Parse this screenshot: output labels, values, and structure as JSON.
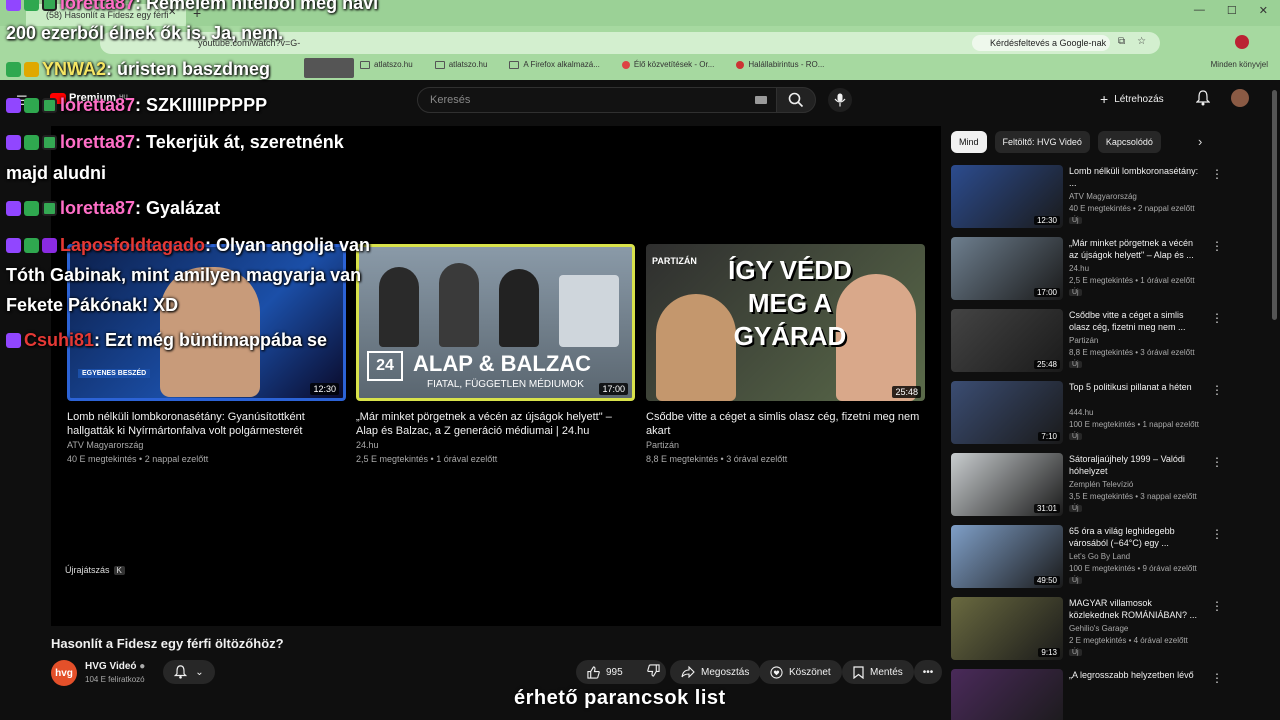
{
  "browser": {
    "tab_title": "(58) Hasonlít a Fidesz egy férfi",
    "url": "youtube.com/watch?v=G-",
    "search_chip": "Kérdésfeltevés a Google-nak",
    "bookmarks": [
      {
        "label": "atlatszo.hu",
        "icon": "folder-icon"
      },
      {
        "label": "atlatszo.hu",
        "icon": "folder-icon"
      },
      {
        "label": "A Firefox alkalmazá...",
        "icon": "folder-icon"
      },
      {
        "label": "Élő közvetítések - Or...",
        "icon": "live-icon"
      },
      {
        "label": "Halállabirintus - RO...",
        "icon": "site-icon"
      }
    ],
    "other_bookmarks": "Minden könyvjel"
  },
  "header": {
    "logo_text": "Premium",
    "logo_region": "HU",
    "search_placeholder": "Keresés",
    "create_label": "Létrehozás"
  },
  "endcards": [
    {
      "title": "Lomb nélküli lombkoronasétány: Gyanúsítottként hallgatták ki Nyírmártonfalva volt polgármesterét",
      "channel": "ATV Magyarország",
      "stats": "40 E megtekintés • 2 nappal ezelőtt",
      "duration": "12:30",
      "thumb_text": "EGYENES BESZÉD",
      "thumb_color": "#1b4fa8"
    },
    {
      "title": "„Már minket pörgetnek a vécén az újságok helyett\" – Alap és Balzac, a Z generáció médiumai | 24.hu",
      "channel": "24.hu",
      "stats": "2,5 E megtekintés • 1 órával ezelőtt",
      "duration": "17:00",
      "thumb_text": "ALAP & BALZAC",
      "thumb_subtext": "FIATAL, FÜGGETLEN MÉDIUMOK",
      "thumb_color": "#6e7f8f"
    },
    {
      "title": "Csődbe vitte a céget a simlis olasz cég, fizetni meg nem akart",
      "channel": "Partizán",
      "stats": "8,8 E megtekintés • 3 órával ezelőtt",
      "duration": "25:48",
      "thumb_text": "ÍGY VÉDD MEG A GYÁRAD",
      "thumb_label": "PARTIZÁN",
      "thumb_color": "#3a3a3a"
    }
  ],
  "player": {
    "replay_label": "Újrajátszás",
    "replay_key": "K"
  },
  "video": {
    "title": "Hasonlít a Fidesz egy férfi öltözőhöz?",
    "channel": "HVG Videó",
    "avatar_text": "hvg",
    "subscribers": "104 E feliratkozó",
    "likes": "995",
    "share_label": "Megosztás",
    "thanks_label": "Köszönet",
    "save_label": "Mentés"
  },
  "sidebar": {
    "chips": [
      "Mind",
      "Feltöltő: HVG Videó",
      "Kapcsolódó"
    ],
    "items": [
      {
        "title": "Lomb nélküli lombkoronasétány: ...",
        "channel": "ATV Magyarország",
        "stats": "40 E megtekintés • 2 nappal ezelőtt",
        "duration": "12:30",
        "badge": "Új",
        "color": "#2c4c8f"
      },
      {
        "title": "„Már minket pörgetnek a vécén az újságok helyett\" – Alap és ...",
        "channel": "24.hu",
        "stats": "2,5 E megtekintés • 1 órával ezelőtt",
        "duration": "17:00",
        "badge": "Új",
        "color": "#6e7f8f"
      },
      {
        "title": "Csődbe vitte a céget a simlis olasz cég, fizetni meg nem ...",
        "channel": "Partizán",
        "stats": "8,8 E megtekintés • 3 órával ezelőtt",
        "duration": "25:48",
        "badge": "Új",
        "color": "#444"
      },
      {
        "title": "Top 5 politikusi pillanat a héten",
        "channel": "444.hu",
        "stats": "100 E megtekintés • 1 nappal ezelőtt",
        "duration": "7:10",
        "badge": "Új",
        "color": "#3b4d73"
      },
      {
        "title": "Sátoraljaújhely 1999 – Valódi hóhelyzet",
        "channel": "Zemplén Televízió",
        "stats": "3,5 E megtekintés • 3 nappal ezelőtt",
        "duration": "31:01",
        "badge": "Új",
        "color": "#c9cdcf"
      },
      {
        "title": "65 óra a világ leghidegebb városából (−64°C) egy ...",
        "channel": "Let's Go By Land",
        "stats": "100 E megtekintés • 9 órával ezelőtt",
        "duration": "49:50",
        "badge": "Új",
        "color": "#7f9fc8"
      },
      {
        "title": "MAGYAR villamosok közlekednek ROMÁNIÁBAN? ...",
        "channel": "Gehilio's Garage",
        "stats": "2 E megtekintés • 4 órával ezelőtt",
        "duration": "9:13",
        "badge": "Új",
        "color": "#6a6a40"
      },
      {
        "title": "„A legrosszabb helyzetben lévő",
        "channel": "",
        "stats": "",
        "duration": "",
        "badge": "",
        "color": "#4a2a5a"
      }
    ]
  },
  "chat": [
    {
      "nick": "loretta87",
      "nick_color": "pink",
      "message": ": Remélem hitelből még havi",
      "cont": "200 ezerből élnek ők is. Ja, nem."
    },
    {
      "nick": "YNWA2",
      "nick_color": "yellow",
      "message": ": úristen baszdmeg",
      "cont": ""
    },
    {
      "nick": "loretta87",
      "nick_color": "pink",
      "message": ": SZKIIIIIPPPPP",
      "cont": ""
    },
    {
      "nick": "loretta87",
      "nick_color": "pink",
      "message": ": Tekerjük át, szeretnénk",
      "cont": "majd aludni"
    },
    {
      "nick": "loretta87",
      "nick_color": "pink",
      "message": ": Gyalázat",
      "cont": ""
    },
    {
      "nick": "Laposfoldtagado",
      "nick_color": "red",
      "message": ": Olyan angolja van",
      "cont": "Tóth Gabinak, mint amilyen magyarja van",
      "cont2": "Fekete Pákónak! XD"
    },
    {
      "nick": "Csuhi81",
      "nick_color": "red",
      "message": ": Ezt még büntimappába se",
      "cont": ""
    }
  ],
  "caption": "érhető parancsok list",
  "colors": {
    "accent": "#ff0000",
    "chat_pink": "#ff6ec7",
    "chat_red": "#e53935",
    "browser_bar": "#a6d9a0"
  }
}
